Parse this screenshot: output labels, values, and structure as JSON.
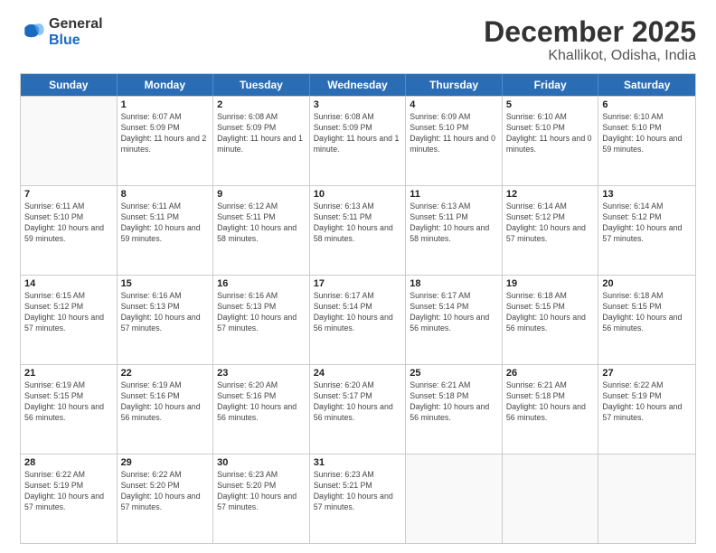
{
  "logo": {
    "general": "General",
    "blue": "Blue"
  },
  "title": "December 2025",
  "subtitle": "Khallikot, Odisha, India",
  "weekdays": [
    "Sunday",
    "Monday",
    "Tuesday",
    "Wednesday",
    "Thursday",
    "Friday",
    "Saturday"
  ],
  "weeks": [
    [
      {
        "day": "",
        "sunrise": "",
        "sunset": "",
        "daylight": "",
        "empty": true
      },
      {
        "day": "1",
        "sunrise": "6:07 AM",
        "sunset": "5:09 PM",
        "daylight": "11 hours and 2 minutes."
      },
      {
        "day": "2",
        "sunrise": "6:08 AM",
        "sunset": "5:09 PM",
        "daylight": "11 hours and 1 minute."
      },
      {
        "day": "3",
        "sunrise": "6:08 AM",
        "sunset": "5:09 PM",
        "daylight": "11 hours and 1 minute."
      },
      {
        "day": "4",
        "sunrise": "6:09 AM",
        "sunset": "5:10 PM",
        "daylight": "11 hours and 0 minutes."
      },
      {
        "day": "5",
        "sunrise": "6:10 AM",
        "sunset": "5:10 PM",
        "daylight": "11 hours and 0 minutes."
      },
      {
        "day": "6",
        "sunrise": "6:10 AM",
        "sunset": "5:10 PM",
        "daylight": "10 hours and 59 minutes."
      }
    ],
    [
      {
        "day": "7",
        "sunrise": "6:11 AM",
        "sunset": "5:10 PM",
        "daylight": "10 hours and 59 minutes."
      },
      {
        "day": "8",
        "sunrise": "6:11 AM",
        "sunset": "5:11 PM",
        "daylight": "10 hours and 59 minutes."
      },
      {
        "day": "9",
        "sunrise": "6:12 AM",
        "sunset": "5:11 PM",
        "daylight": "10 hours and 58 minutes."
      },
      {
        "day": "10",
        "sunrise": "6:13 AM",
        "sunset": "5:11 PM",
        "daylight": "10 hours and 58 minutes."
      },
      {
        "day": "11",
        "sunrise": "6:13 AM",
        "sunset": "5:11 PM",
        "daylight": "10 hours and 58 minutes."
      },
      {
        "day": "12",
        "sunrise": "6:14 AM",
        "sunset": "5:12 PM",
        "daylight": "10 hours and 57 minutes."
      },
      {
        "day": "13",
        "sunrise": "6:14 AM",
        "sunset": "5:12 PM",
        "daylight": "10 hours and 57 minutes."
      }
    ],
    [
      {
        "day": "14",
        "sunrise": "6:15 AM",
        "sunset": "5:12 PM",
        "daylight": "10 hours and 57 minutes."
      },
      {
        "day": "15",
        "sunrise": "6:16 AM",
        "sunset": "5:13 PM",
        "daylight": "10 hours and 57 minutes."
      },
      {
        "day": "16",
        "sunrise": "6:16 AM",
        "sunset": "5:13 PM",
        "daylight": "10 hours and 57 minutes."
      },
      {
        "day": "17",
        "sunrise": "6:17 AM",
        "sunset": "5:14 PM",
        "daylight": "10 hours and 56 minutes."
      },
      {
        "day": "18",
        "sunrise": "6:17 AM",
        "sunset": "5:14 PM",
        "daylight": "10 hours and 56 minutes."
      },
      {
        "day": "19",
        "sunrise": "6:18 AM",
        "sunset": "5:15 PM",
        "daylight": "10 hours and 56 minutes."
      },
      {
        "day": "20",
        "sunrise": "6:18 AM",
        "sunset": "5:15 PM",
        "daylight": "10 hours and 56 minutes."
      }
    ],
    [
      {
        "day": "21",
        "sunrise": "6:19 AM",
        "sunset": "5:15 PM",
        "daylight": "10 hours and 56 minutes."
      },
      {
        "day": "22",
        "sunrise": "6:19 AM",
        "sunset": "5:16 PM",
        "daylight": "10 hours and 56 minutes."
      },
      {
        "day": "23",
        "sunrise": "6:20 AM",
        "sunset": "5:16 PM",
        "daylight": "10 hours and 56 minutes."
      },
      {
        "day": "24",
        "sunrise": "6:20 AM",
        "sunset": "5:17 PM",
        "daylight": "10 hours and 56 minutes."
      },
      {
        "day": "25",
        "sunrise": "6:21 AM",
        "sunset": "5:18 PM",
        "daylight": "10 hours and 56 minutes."
      },
      {
        "day": "26",
        "sunrise": "6:21 AM",
        "sunset": "5:18 PM",
        "daylight": "10 hours and 56 minutes."
      },
      {
        "day": "27",
        "sunrise": "6:22 AM",
        "sunset": "5:19 PM",
        "daylight": "10 hours and 57 minutes."
      }
    ],
    [
      {
        "day": "28",
        "sunrise": "6:22 AM",
        "sunset": "5:19 PM",
        "daylight": "10 hours and 57 minutes."
      },
      {
        "day": "29",
        "sunrise": "6:22 AM",
        "sunset": "5:20 PM",
        "daylight": "10 hours and 57 minutes."
      },
      {
        "day": "30",
        "sunrise": "6:23 AM",
        "sunset": "5:20 PM",
        "daylight": "10 hours and 57 minutes."
      },
      {
        "day": "31",
        "sunrise": "6:23 AM",
        "sunset": "5:21 PM",
        "daylight": "10 hours and 57 minutes."
      },
      {
        "day": "",
        "sunrise": "",
        "sunset": "",
        "daylight": "",
        "empty": true
      },
      {
        "day": "",
        "sunrise": "",
        "sunset": "",
        "daylight": "",
        "empty": true
      },
      {
        "day": "",
        "sunrise": "",
        "sunset": "",
        "daylight": "",
        "empty": true
      }
    ]
  ]
}
